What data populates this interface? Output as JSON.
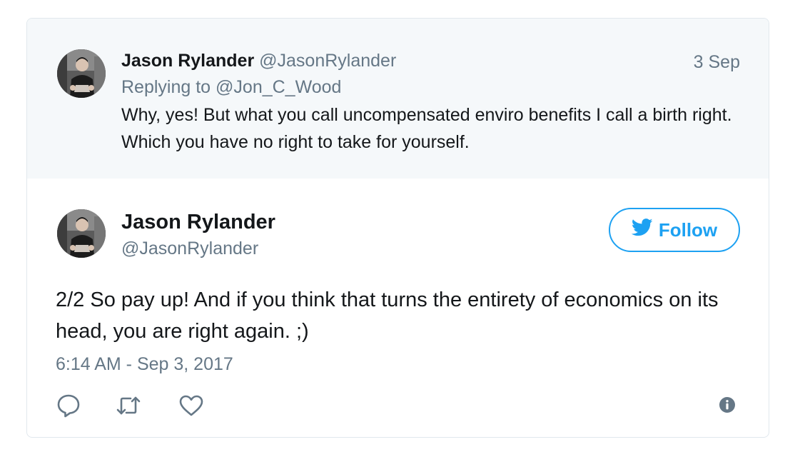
{
  "parent_tweet": {
    "author_name": "Jason Rylander",
    "author_handle": "@JasonRylander",
    "date": "3 Sep",
    "replying_prefix": "Replying to ",
    "replying_to": "@Jon_C_Wood",
    "text": "Why, yes! But what you call uncompensated enviro benefits I call a birth right. Which you have no right to take for yourself."
  },
  "main_tweet": {
    "author_name": "Jason Rylander",
    "author_handle": "@JasonRylander",
    "follow_label": "Follow",
    "text": "2/2 So pay up! And if you think that turns the entirety of economics on its head, you are right again. ;)",
    "timestamp": "6:14 AM - Sep 3, 2017"
  },
  "actions": {
    "reply_icon": "reply-icon",
    "retweet_icon": "retweet-icon",
    "like_icon": "heart-icon",
    "info_icon": "info-icon"
  },
  "colors": {
    "twitter_blue": "#1da1f2",
    "muted_text": "#657786",
    "body_text": "#14171a",
    "parent_background": "#f5f8fa",
    "border": "#e1e8ed"
  }
}
